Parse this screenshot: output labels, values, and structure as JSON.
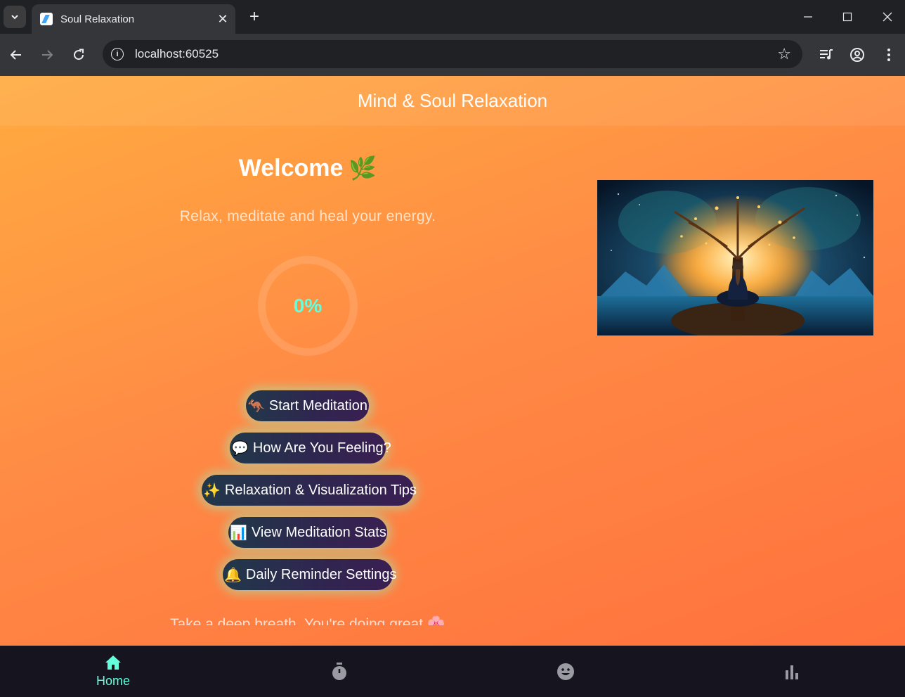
{
  "browser": {
    "tab_title": "Soul Relaxation",
    "url": "localhost:60525"
  },
  "app": {
    "title": "Mind & Soul Relaxation",
    "welcome": "Welcome",
    "welcome_icon": "leaf-icon",
    "subtitle": "Relax, meditate and heal your energy.",
    "progress": {
      "value": 0,
      "label": "0%"
    },
    "buttons": [
      {
        "emoji": "🦘",
        "label": "Start Meditation"
      },
      {
        "emoji": "💬",
        "label": "How Are You Feeling?"
      },
      {
        "emoji": "✨",
        "label": "Relaxation & Visualization Tips"
      },
      {
        "emoji": "📊",
        "label": "View Meditation Stats"
      },
      {
        "emoji": "🔔",
        "label": "Daily Reminder Settings"
      }
    ],
    "footer_message": "Take a deep breath. You're doing great 🌸"
  },
  "bottom_nav": {
    "items": [
      {
        "label": "Home",
        "icon": "home-icon",
        "active": true
      },
      {
        "label": "",
        "icon": "timer-icon",
        "active": false
      },
      {
        "label": "",
        "icon": "mood-icon",
        "active": false
      },
      {
        "label": "",
        "icon": "bar-chart-icon",
        "active": false
      }
    ]
  },
  "colors": {
    "accent": "#64ffda",
    "background_start": "#ffab40",
    "background_end": "#ff6f3c",
    "nav_background": "#16141f"
  }
}
